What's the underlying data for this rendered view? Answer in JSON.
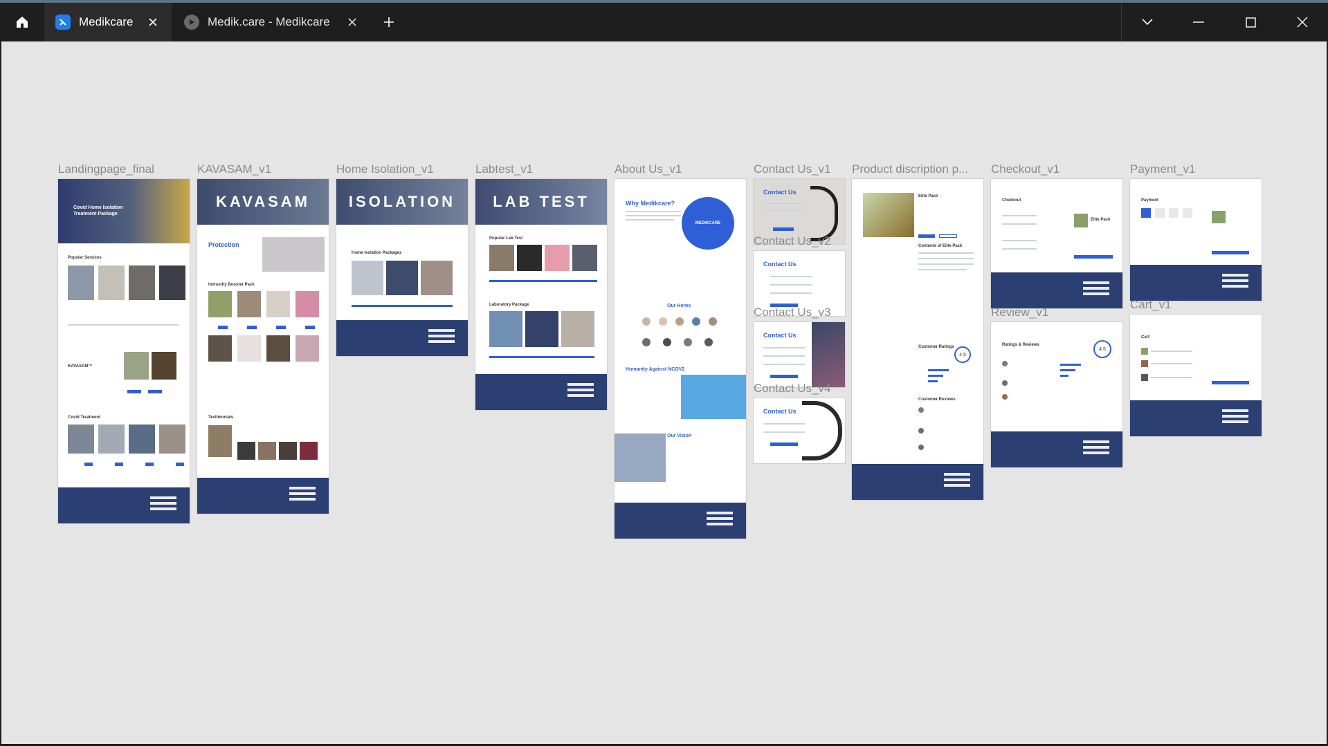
{
  "tabs": [
    {
      "label": "Medikcare",
      "active": true,
      "icon": "app-icon"
    },
    {
      "label": "Medik.care - Medikcare",
      "active": false,
      "icon": "play-icon"
    }
  ],
  "window_controls": [
    "chevron-down-icon",
    "minimize-icon",
    "maximize-icon",
    "close-icon"
  ],
  "frames": {
    "landing": {
      "label": "Landingpage_final",
      "hero_title": "Covid Home Isolation Treatment Package",
      "s1": "Popular Services",
      "s2": "KAVASAM™",
      "s3": "Covid Treatment"
    },
    "kavasam": {
      "label": "KAVASAM_v1",
      "hero_title": "KAVASAM",
      "protection": "Protection",
      "s1": "Immunity Booster Pack",
      "s2": "Testimonials"
    },
    "home_isolation": {
      "label": "Home Isolation_v1",
      "hero_title": "ISOLATION",
      "s1": "Home Isolation Packages"
    },
    "labtest": {
      "label": "Labtest_v1",
      "hero_title": "LAB TEST",
      "s1": "Popular Lab Test",
      "s2": "Laboratory Package"
    },
    "about": {
      "label": "About Us_v1",
      "why": "Why Medikcare?",
      "logo": "MEDIKCARE",
      "heros": "Our Heros",
      "ncov": "Humanity Against NCOV2",
      "vision": "Our Vision"
    },
    "contact1": {
      "label": "Contact Us_v1",
      "title": "Contact Us"
    },
    "contact2": {
      "label": "Contact Us_v2",
      "title": "Contact Us"
    },
    "contact3": {
      "label": "Contact Us_v3",
      "title": "Contact Us"
    },
    "contact4": {
      "label": "Contact Us_v4",
      "title": "Contact Us"
    },
    "product": {
      "label": "Product discription p...",
      "s1": "Elite Pack",
      "s2": "Contents of Elite Pack",
      "s3": "Customer Ratings",
      "rating": "4.5",
      "s4": "Customer Reviews"
    },
    "checkout": {
      "label": "Checkout_v1",
      "title": "Checkout",
      "item": "Elite Pack"
    },
    "review": {
      "label": "Review_v1",
      "title": "Ratings & Reviews",
      "rating": "4.5"
    },
    "payment": {
      "label": "Payment_v1",
      "title": "Payment"
    },
    "cart": {
      "label": "Cart_v1",
      "title": "Cart"
    }
  },
  "colors": {
    "accent": "#2f5fd7",
    "footer": "#2b3f73",
    "canvas": "#e5e5e5",
    "titlebar": "#1e1e1e"
  }
}
